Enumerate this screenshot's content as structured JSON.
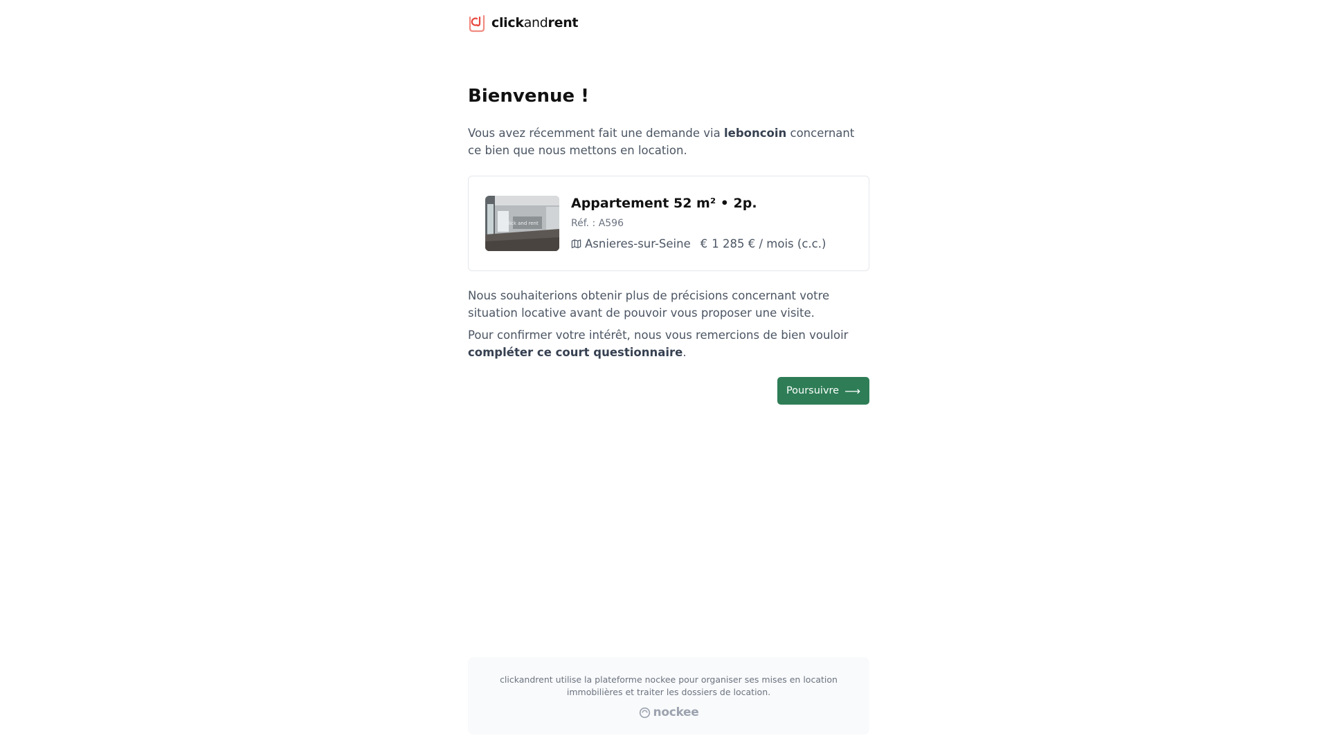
{
  "brand": {
    "name_bold": "click",
    "name_thin": "and",
    "name_end": "rent",
    "accent": "#e8453c"
  },
  "heading": "Bienvenue !",
  "intro": {
    "before": "Vous avez récemment fait une demande via ",
    "highlight": "leboncoin",
    "after": " concernant ce bien que nous mettons en location."
  },
  "listing": {
    "title": "Appartement 52 m² • 2p.",
    "ref": "Réf. : A596",
    "city": "Asnieres-sur-Seine",
    "price": "1 285 € / mois (c.c.)",
    "map_icon": "map-icon",
    "currency_icon": "€"
  },
  "paragraph2": "Nous souhaiterions obtenir plus de précisions concernant votre situation locative avant de pouvoir vous proposer une visite.",
  "paragraph3": {
    "before": "Pour confirmer votre intérêt, nous vous remercions de bien vouloir ",
    "highlight": "compléter ce court questionnaire",
    "after": "."
  },
  "cta": {
    "label": "Poursuivre",
    "arrow": "⟶",
    "color": "#2e7d56"
  },
  "footer": {
    "text": "clickandrent utilise la plateforme nockee pour organiser ses mises en location immobilières et traiter les dossiers de location.",
    "logo": "nockee"
  }
}
